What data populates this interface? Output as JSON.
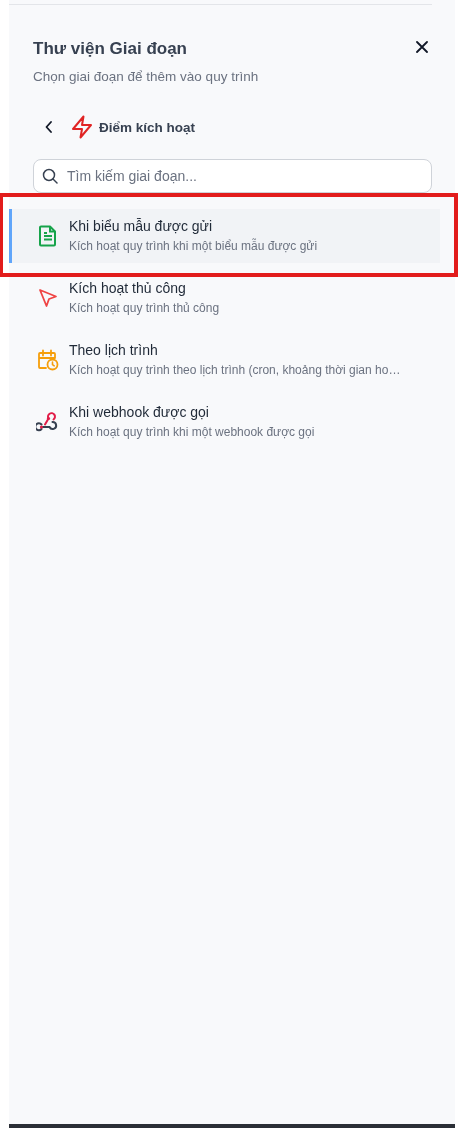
{
  "panel": {
    "title": "Thư viện Giai đoạn",
    "subtitle": "Chọn giai đoạn để thêm vào quy trình"
  },
  "category": {
    "label": "Điểm kích hoạt"
  },
  "search": {
    "placeholder": "Tìm kiếm giai đoạn..."
  },
  "stages": [
    {
      "kind": "form",
      "title": "Khi biểu mẫu được gửi",
      "description": "Kích hoạt quy trình khi một biểu mẫu được gửi",
      "selected": true,
      "annotated": true
    },
    {
      "kind": "manual",
      "title": "Kích hoạt thủ công",
      "description": "Kích hoạt quy trình thủ công",
      "selected": false,
      "annotated": false
    },
    {
      "kind": "schedule",
      "title": "Theo lịch trình",
      "description": "Kích hoạt quy trình theo lịch trình (cron, khoảng thời gian ho…",
      "selected": false,
      "annotated": false
    },
    {
      "kind": "webhook",
      "title": "Khi webhook được gọi",
      "description": "Kích hoạt quy trình khi một webhook được gọi",
      "selected": false,
      "annotated": false
    }
  ]
}
